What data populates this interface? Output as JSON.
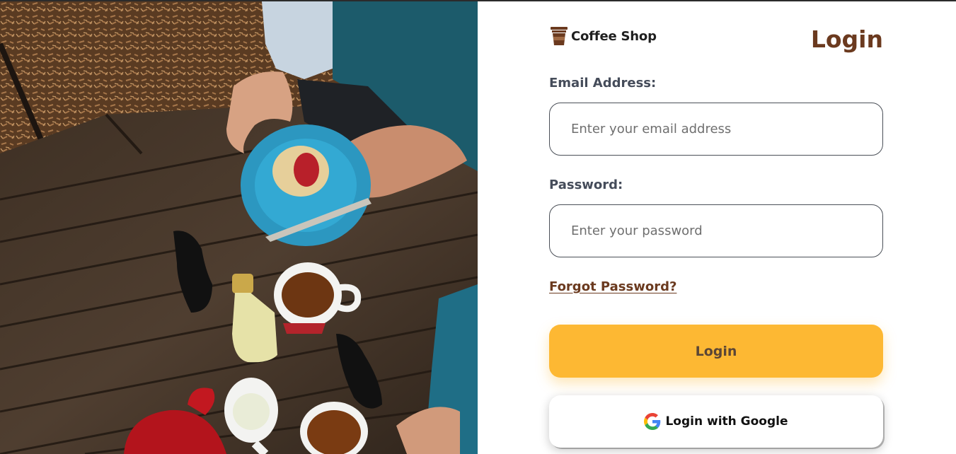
{
  "brand": {
    "name": "Coffee Shop",
    "icon": "coffee-cup-icon"
  },
  "title": "Login",
  "email": {
    "label": "Email Address:",
    "placeholder": "Enter your email address",
    "value": ""
  },
  "password": {
    "label": "Password:",
    "placeholder": "Enter your password",
    "value": ""
  },
  "forgot_link": "Forgot Password?",
  "login_button": "Login",
  "google_button": {
    "label": "Login with Google",
    "icon": "google-icon"
  },
  "colors": {
    "accent_brown": "#6b3a1f",
    "button_yellow": "#fdb833",
    "label_gray": "#454c5a"
  }
}
